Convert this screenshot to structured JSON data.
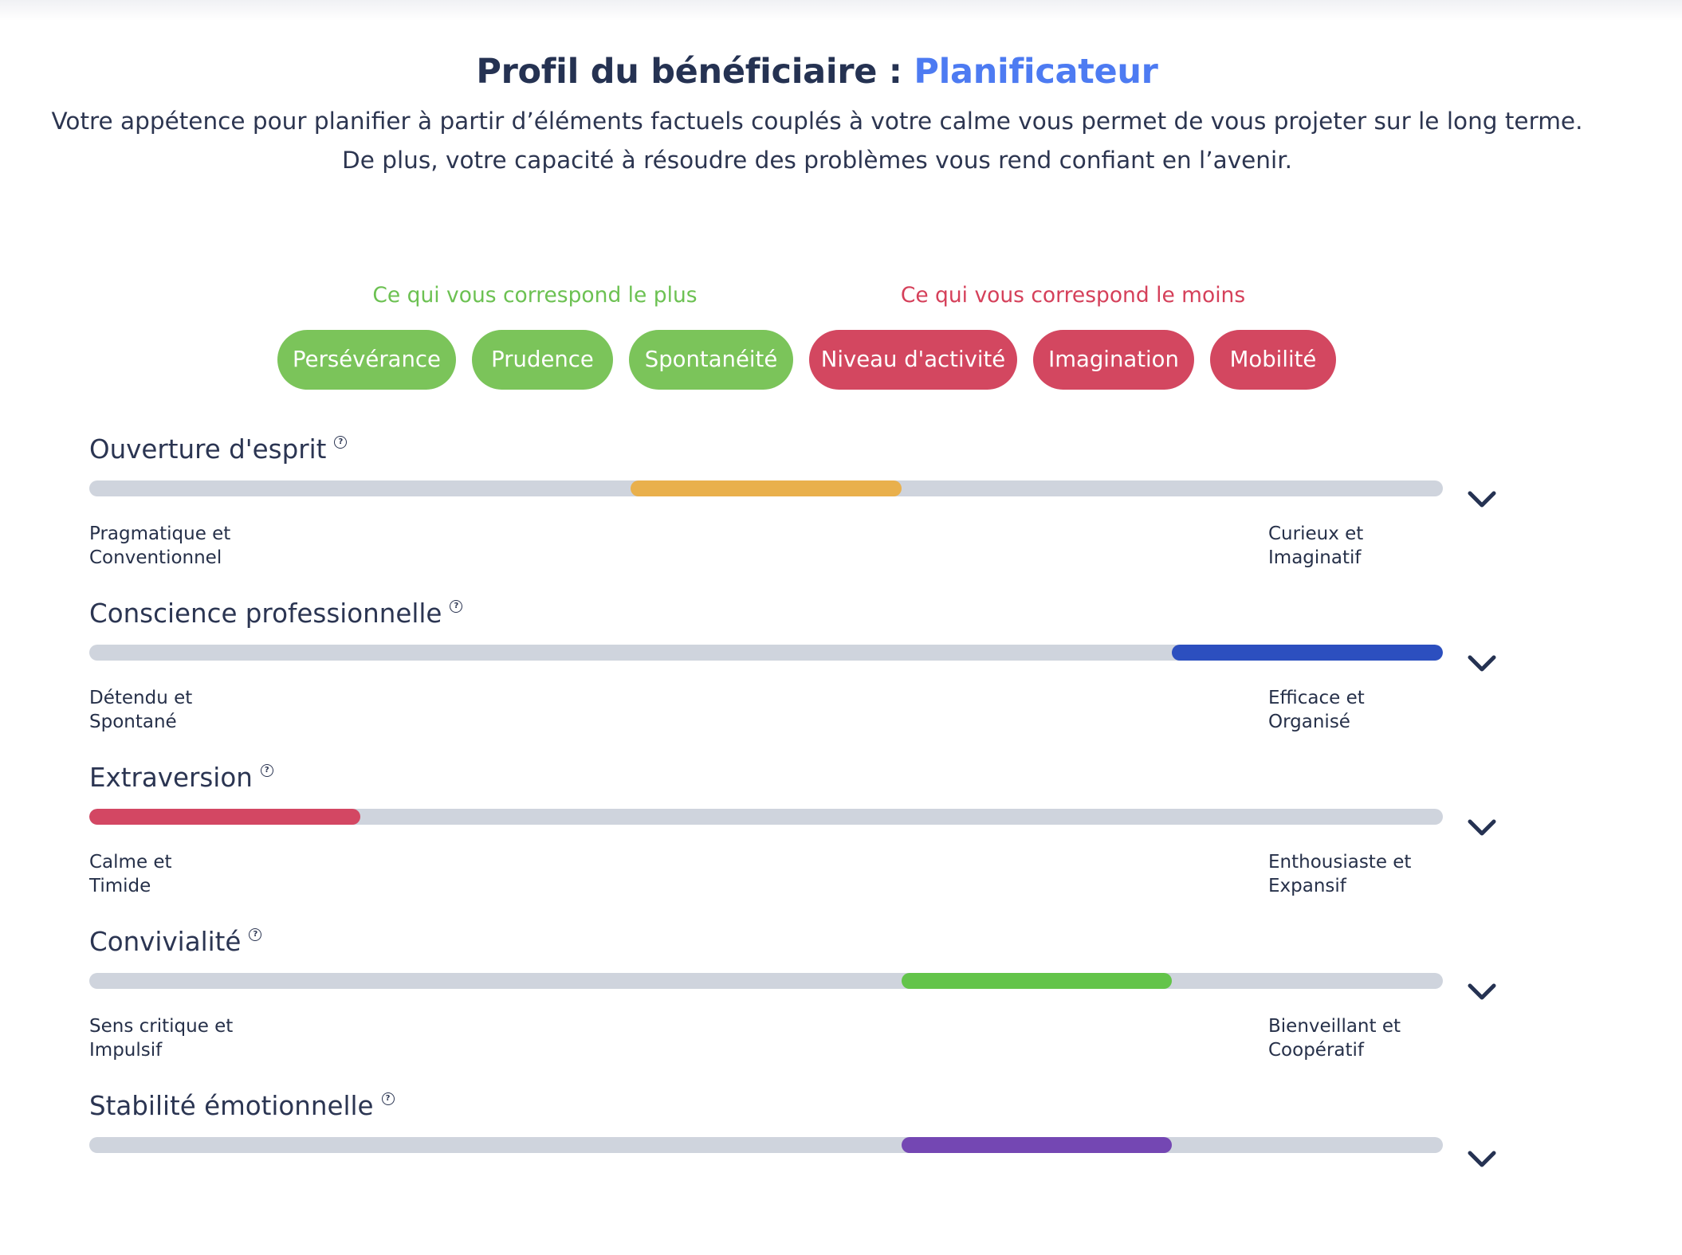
{
  "header": {
    "title_prefix": "Profil du bénéficiaire : ",
    "title_profile": "Planificateur",
    "description_line1": "Votre appétence pour planifier à partir d’éléments factuels couplés à votre calme vous permet de vous projeter sur le long terme.",
    "description_line2": "De plus, votre capacité à résoudre des problèmes vous rend confiant en l’avenir."
  },
  "correspondence": {
    "plus_label": "Ce qui vous correspond le plus",
    "moins_label": "Ce qui vous correspond le moins",
    "plus_tags": [
      "Persévérance",
      "Prudence",
      "Spontanéité"
    ],
    "moins_tags": [
      "Niveau d'activité",
      "Imagination",
      "Mobilité"
    ],
    "plus_color": "#7bc45a",
    "moins_color": "#d34760"
  },
  "traits": [
    {
      "name": "Ouverture d'esprit",
      "help_icon": "question-circle-icon",
      "left_pole": [
        "Pragmatique et",
        "Conventionnel"
      ],
      "right_pole": [
        "Curieux et",
        "Imaginatif"
      ],
      "segment": 3,
      "segments_total": 5,
      "color": "#e9b04c"
    },
    {
      "name": "Conscience professionnelle",
      "help_icon": "question-circle-icon",
      "left_pole": [
        "Détendu et",
        "Spontané"
      ],
      "right_pole": [
        "Efficace et",
        "Organisé"
      ],
      "segment": 5,
      "segments_total": 5,
      "color": "#2c4fbf"
    },
    {
      "name": "Extraversion",
      "help_icon": "question-circle-icon",
      "left_pole": [
        "Calme et",
        "Timide"
      ],
      "right_pole": [
        "Enthousiaste et",
        "Expansif"
      ],
      "segment": 1,
      "segments_total": 5,
      "color": "#d34763"
    },
    {
      "name": "Convivialité",
      "help_icon": "question-circle-icon",
      "left_pole": [
        "Sens critique et",
        "Impulsif"
      ],
      "right_pole": [
        "Bienveillant et",
        "Coopératif"
      ],
      "segment": 4,
      "segments_total": 5,
      "color": "#63c44a"
    },
    {
      "name": "Stabilité émotionnelle",
      "help_icon": "question-circle-icon",
      "left_pole": [
        "",
        ""
      ],
      "right_pole": [
        "",
        ""
      ],
      "segment": 4,
      "segments_total": 5,
      "color": "#7447b3"
    }
  ],
  "icons": {
    "expand": "chevron-down-icon",
    "help": "question-circle-icon"
  }
}
